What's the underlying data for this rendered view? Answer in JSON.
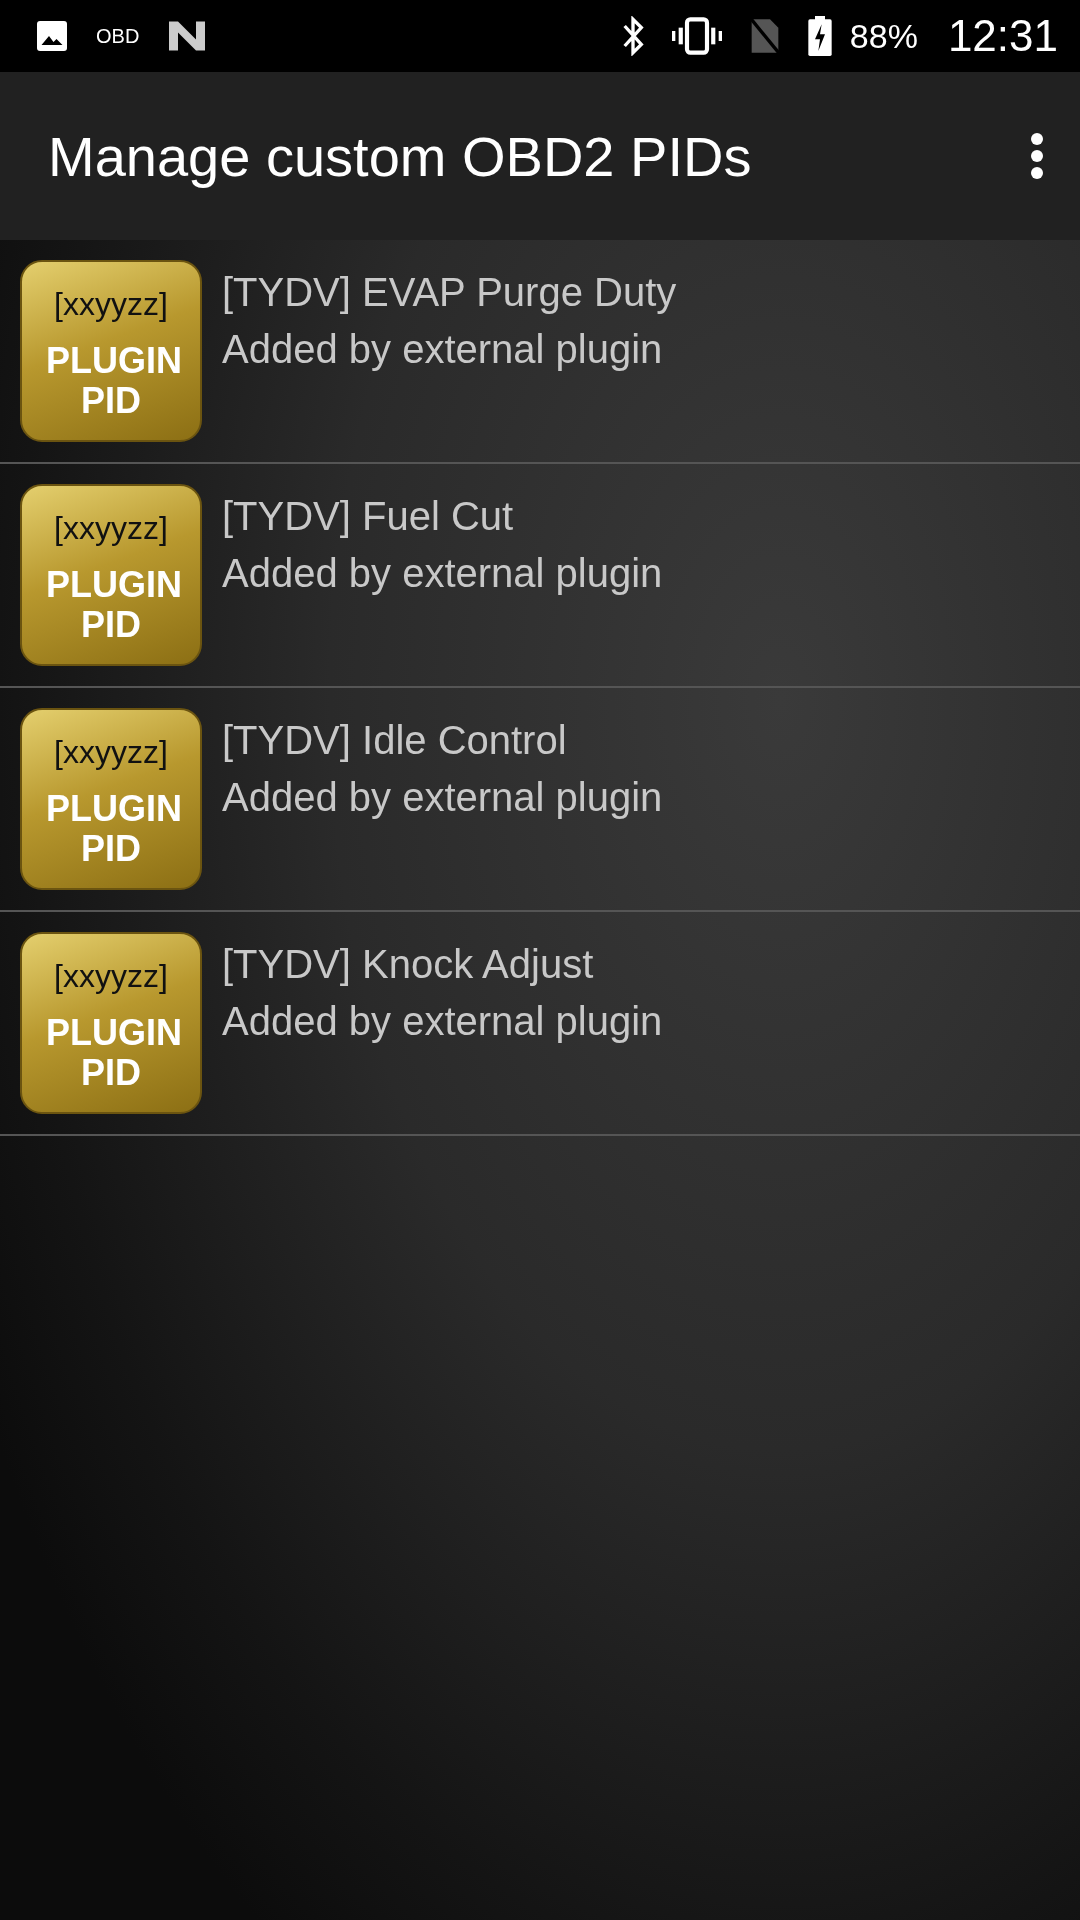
{
  "status_bar": {
    "left": [
      "OBD"
    ],
    "battery": "88%",
    "time": "12:31"
  },
  "app_bar": {
    "title": "Manage custom OBD2 PIDs"
  },
  "items": [
    {
      "badge_code": "[xxyyzz]",
      "badge_label": "PLUGIN PID",
      "title": "[TYDV] EVAP Purge Duty",
      "subtitle": "Added by external plugin"
    },
    {
      "badge_code": "[xxyyzz]",
      "badge_label": "PLUGIN PID",
      "title": "[TYDV] Fuel Cut",
      "subtitle": "Added by external plugin"
    },
    {
      "badge_code": "[xxyyzz]",
      "badge_label": "PLUGIN PID",
      "title": "[TYDV] Idle Control",
      "subtitle": "Added by external plugin"
    },
    {
      "badge_code": "[xxyyzz]",
      "badge_label": "PLUGIN PID",
      "title": "[TYDV] Knock Adjust",
      "subtitle": "Added by external plugin"
    }
  ]
}
